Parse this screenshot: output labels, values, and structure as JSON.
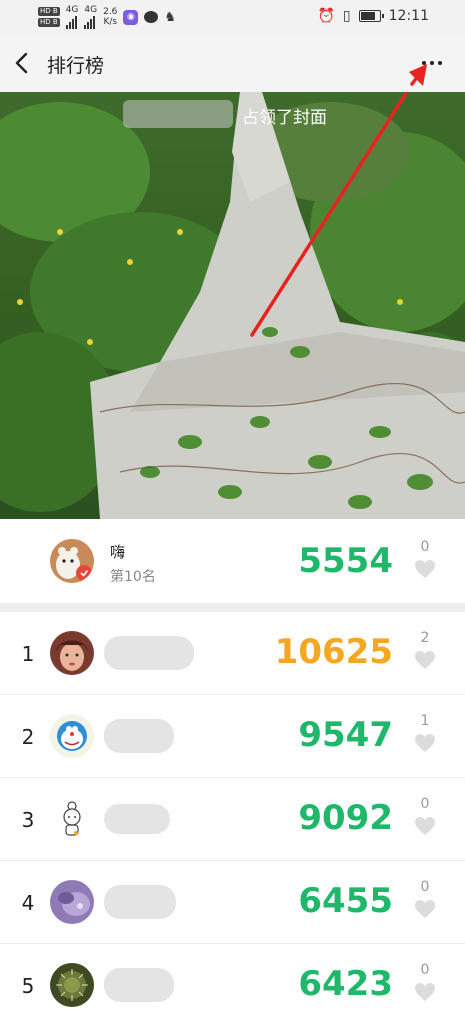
{
  "status_bar": {
    "hd1": "HD B",
    "hd2": "HD B",
    "net1": "4G",
    "net2": "4G",
    "speed": "2.6",
    "speed_unit": "K/s",
    "time": "12:11"
  },
  "nav": {
    "title": "排行榜"
  },
  "cover": {
    "caption": "占领了封面"
  },
  "my_entry": {
    "name": "嗨",
    "rank_text": "第10名",
    "steps": "5554",
    "likes": "0"
  },
  "leaderboard": [
    {
      "rank": "1",
      "steps": "10625",
      "likes": "2"
    },
    {
      "rank": "2",
      "steps": "9547",
      "likes": "1"
    },
    {
      "rank": "3",
      "steps": "9092",
      "likes": "0"
    },
    {
      "rank": "4",
      "steps": "6455",
      "likes": "0"
    },
    {
      "rank": "5",
      "steps": "6423",
      "likes": "0"
    }
  ],
  "colors": {
    "green": "#1fb86a",
    "orange": "#f5a623",
    "arrow": "#e8231f"
  }
}
